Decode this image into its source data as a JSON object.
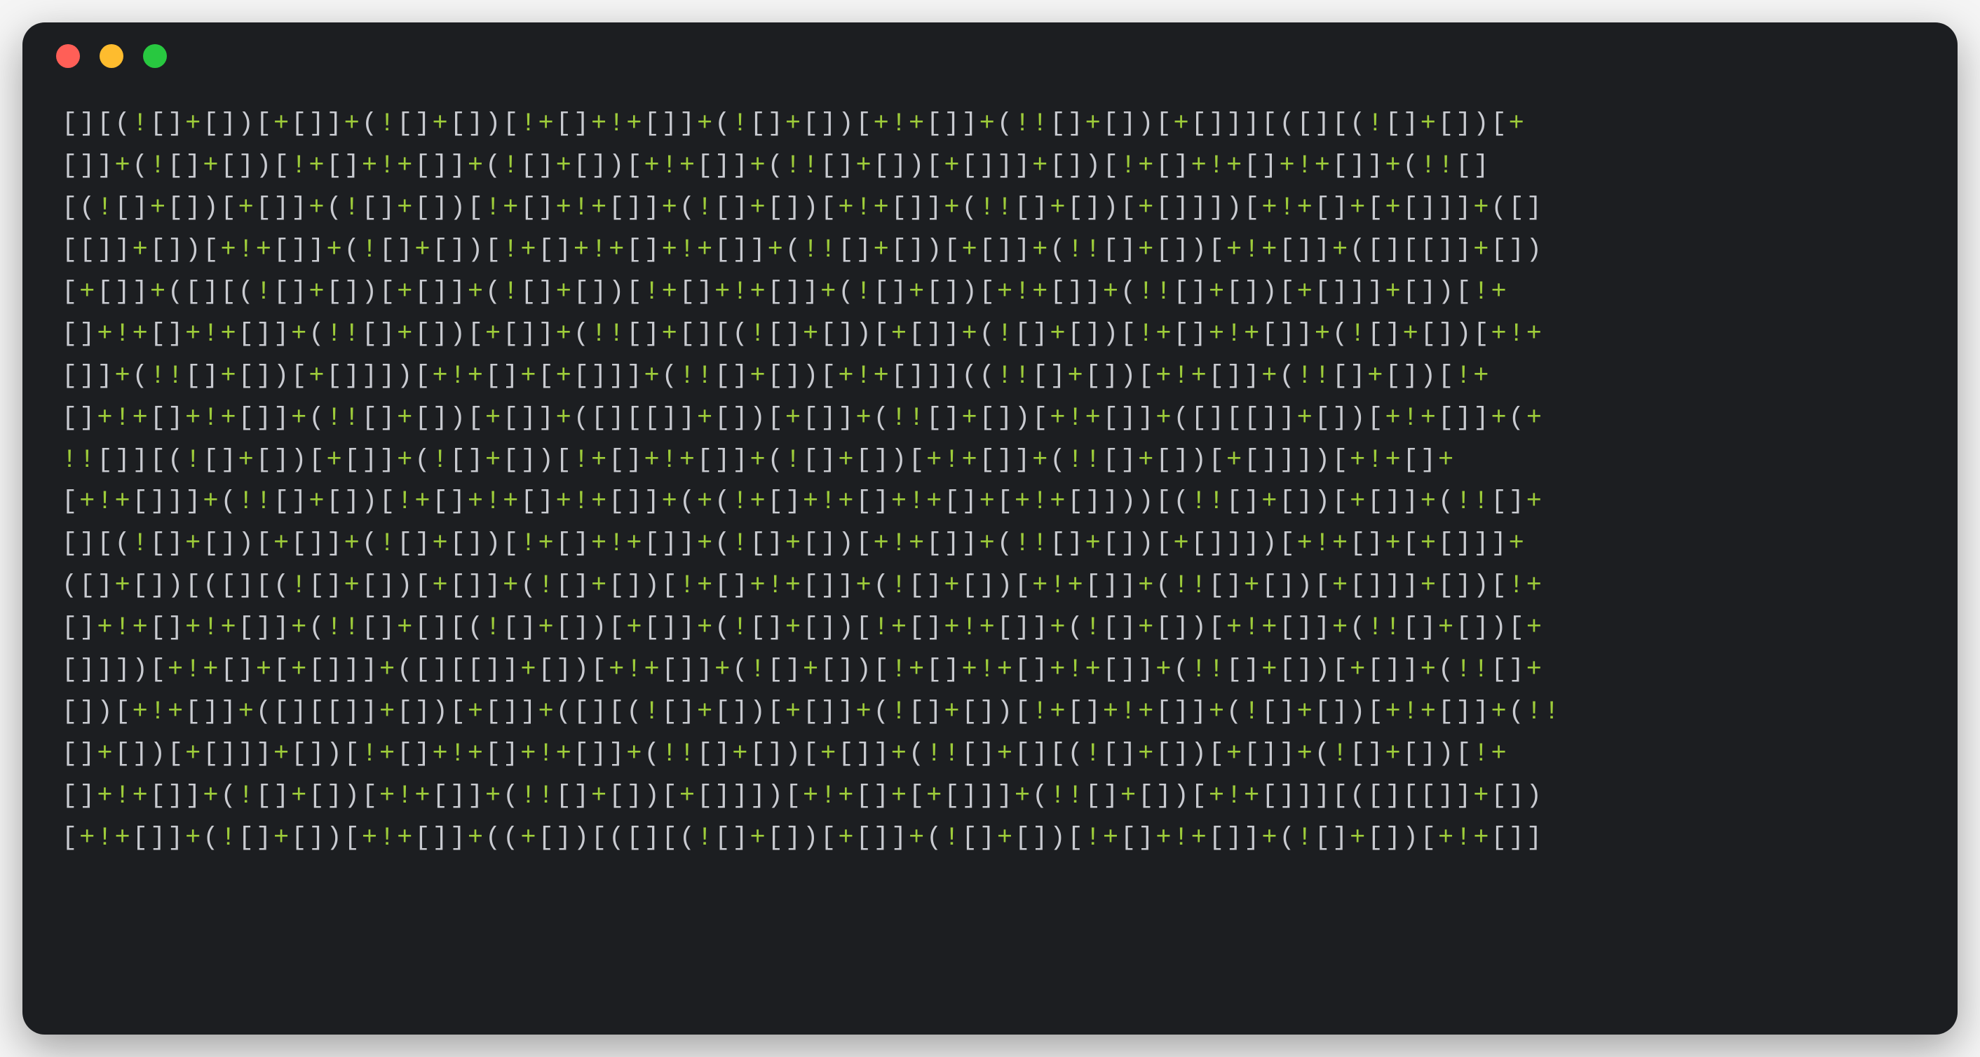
{
  "window": {
    "traffic_lights": {
      "red": "#ff5f57",
      "yellow": "#febc2e",
      "green": "#28c840"
    },
    "background": "#1c1e21"
  },
  "syntax_colors": {
    "punctuation": "#c9cbd1",
    "operator": "#9ecc3a"
  },
  "code_lines": [
    "[][(![]+[])[+[]]+(![]+[])[!+[]+!+[]]+(![]+[])[+!+[]]+(!![]+[])[+[]]][([][(![]+[])[+",
    "[]]+(![]+[])[!+[]+!+[]]+(![]+[])[+!+[]]+(!![]+[])[+[]]]+[])[!+[]+!+[]+!+[]]+(!![]",
    "[(![]+[])[+[]]+(![]+[])[!+[]+!+[]]+(![]+[])[+!+[]]+(!![]+[])[+[]]])[+!+[]+[+[]]]+([]",
    "[[]]+[])[+!+[]]+(![]+[])[!+[]+!+[]+!+[]]+(!![]+[])[+[]]+(!![]+[])[+!+[]]+([][[]]+[])",
    "[+[]]+([][(![]+[])[+[]]+(![]+[])[!+[]+!+[]]+(![]+[])[+!+[]]+(!![]+[])[+[]]]+[])[!+",
    "[]+!+[]+!+[]]+(!![]+[])[+[]]+(!![]+[][(![]+[])[+[]]+(![]+[])[!+[]+!+[]]+(![]+[])[+!+",
    "[]]+(!![]+[])[+[]]])[+!+[]+[+[]]]+(!![]+[])[+!+[]]]((!![]+[])[+!+[]]+(!![]+[])[!+",
    "[]+!+[]+!+[]]+(!![]+[])[+[]]+([][[]]+[])[+[]]+(!![]+[])[+!+[]]+([][[]]+[])[+!+[]]+(+",
    "!![]][(![]+[])[+[]]+(![]+[])[!+[]+!+[]]+(![]+[])[+!+[]]+(!![]+[])[+[]]])[+!+[]+",
    "[+!+[]]]+(!![]+[])[!+[]+!+[]+!+[]]+(+(!+[]+!+[]+!+[]+[+!+[]]))[(!![]+[])[+[]]+(!![]+",
    "[][(![]+[])[+[]]+(![]+[])[!+[]+!+[]]+(![]+[])[+!+[]]+(!![]+[])[+[]]])[+!+[]+[+[]]]+",
    "([]+[])[([][(![]+[])[+[]]+(![]+[])[!+[]+!+[]]+(![]+[])[+!+[]]+(!![]+[])[+[]]]+[])[!+",
    "[]+!+[]+!+[]]+(!![]+[][(![]+[])[+[]]+(![]+[])[!+[]+!+[]]+(![]+[])[+!+[]]+(!![]+[])[+",
    "[]]])[+!+[]+[+[]]]+([][[]]+[])[+!+[]]+(![]+[])[!+[]+!+[]+!+[]]+(!![]+[])[+[]]+(!![]+",
    "[])[+!+[]]+([][[]]+[])[+[]]+([][(![]+[])[+[]]+(![]+[])[!+[]+!+[]]+(![]+[])[+!+[]]+(!!",
    "[]+[])[+[]]]+[])[!+[]+!+[]+!+[]]+(!![]+[])[+[]]+(!![]+[][(![]+[])[+[]]+(![]+[])[!+",
    "[]+!+[]]+(![]+[])[+!+[]]+(!![]+[])[+[]]])[+!+[]+[+[]]]+(!![]+[])[+!+[]]][([][[]]+[])",
    "[+!+[]]+(![]+[])[+!+[]]+((+[])[([][(![]+[])[+[]]+(![]+[])[!+[]+!+[]]+(![]+[])[+!+[]]"
  ]
}
